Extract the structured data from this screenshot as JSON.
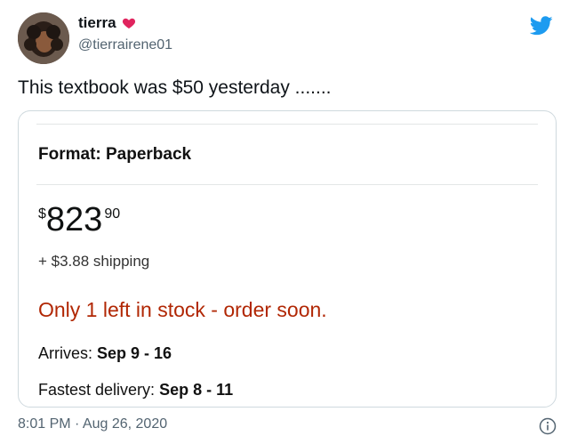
{
  "author": {
    "display_name": "tierra",
    "handle": "@tierrairene01",
    "name_emoji": "heart-icon"
  },
  "tweet": {
    "text": "This textbook was $50 yesterday .......",
    "timestamp": "8:01 PM · Aug 26, 2020"
  },
  "card": {
    "format_label": "Format: Paperback",
    "price": {
      "symbol": "$",
      "whole": "823",
      "fraction": "90"
    },
    "shipping": "+ $3.88 shipping",
    "stock_warning": "Only 1 left in stock - order soon.",
    "arrives_label": "Arrives:",
    "arrives_value": "Sep 9 - 16",
    "fastest_label": "Fastest delivery:",
    "fastest_value": "Sep 8 - 11"
  },
  "colors": {
    "twitter_blue": "#1d9bf0",
    "stock_red": "#b12704",
    "heart_red": "#e0245e"
  },
  "icons": {
    "brand": "twitter-bird-icon",
    "info": "info-icon"
  }
}
